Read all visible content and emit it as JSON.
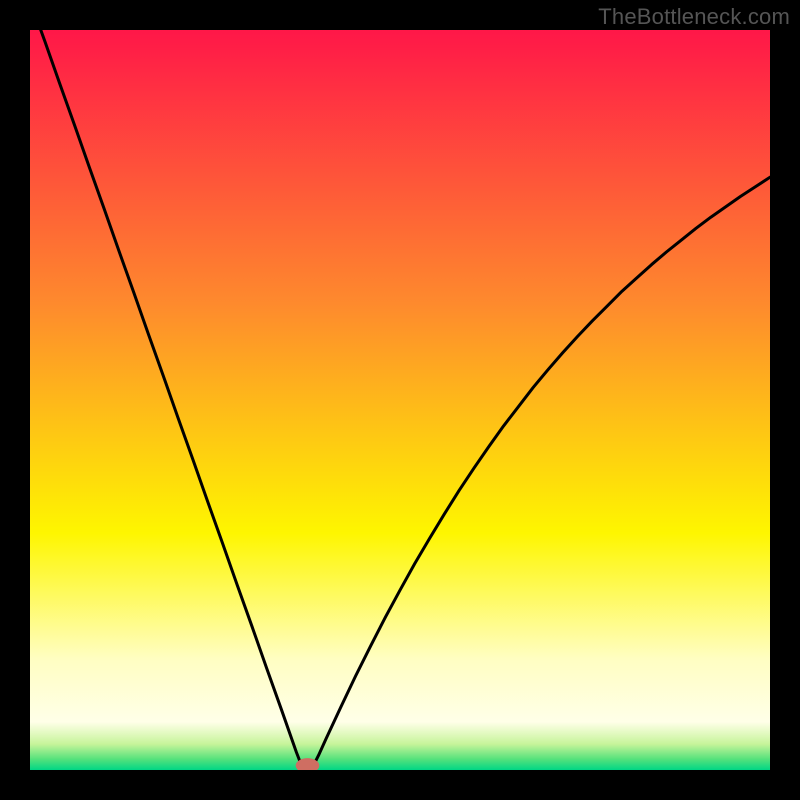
{
  "watermark": "TheBottleneck.com",
  "colors": {
    "background": "#000000",
    "curve": "#000000",
    "marker_fill": "#cf6e62",
    "gradient_stops": [
      {
        "offset": 0.0,
        "color": "#ff1748"
      },
      {
        "offset": 0.37,
        "color": "#fe8a2d"
      },
      {
        "offset": 0.68,
        "color": "#fef600"
      },
      {
        "offset": 0.85,
        "color": "#fffec2"
      },
      {
        "offset": 0.935,
        "color": "#ffffe8"
      },
      {
        "offset": 0.965,
        "color": "#c6f49a"
      },
      {
        "offset": 0.985,
        "color": "#57e27c"
      },
      {
        "offset": 1.0,
        "color": "#00d685"
      }
    ]
  },
  "chart_data": {
    "type": "line",
    "title": "",
    "xlabel": "",
    "ylabel": "",
    "xlim": [
      0,
      100
    ],
    "ylim": [
      0,
      100
    ],
    "x": [
      0,
      2,
      4,
      6,
      8,
      10,
      12,
      14,
      16,
      18,
      20,
      22,
      24,
      26,
      28,
      30,
      32,
      34,
      36,
      36.5,
      37,
      37.5,
      38,
      38.5,
      39,
      40,
      42,
      44,
      46,
      48,
      50,
      52,
      54,
      56,
      58,
      60,
      62,
      64,
      66,
      68,
      70,
      72,
      74,
      76,
      78,
      80,
      82,
      84,
      86,
      88,
      90,
      92,
      94,
      96,
      98,
      100
    ],
    "values": [
      104,
      98.5,
      92.8,
      87.2,
      81.5,
      75.9,
      70.2,
      64.6,
      58.9,
      53.3,
      47.6,
      42.0,
      36.3,
      30.7,
      25.0,
      19.4,
      13.7,
      8.1,
      2.4,
      1.1,
      0.3,
      0.05,
      0.3,
      1.0,
      2.0,
      4.2,
      8.5,
      12.7,
      16.7,
      20.6,
      24.3,
      27.9,
      31.3,
      34.6,
      37.8,
      40.8,
      43.7,
      46.5,
      49.1,
      51.7,
      54.1,
      56.4,
      58.6,
      60.7,
      62.7,
      64.7,
      66.5,
      68.3,
      70.0,
      71.6,
      73.2,
      74.7,
      76.1,
      77.5,
      78.8,
      80.1
    ],
    "marker": {
      "x": 37.5,
      "y": 0.6,
      "rx": 1.6,
      "ry": 1.0
    }
  }
}
